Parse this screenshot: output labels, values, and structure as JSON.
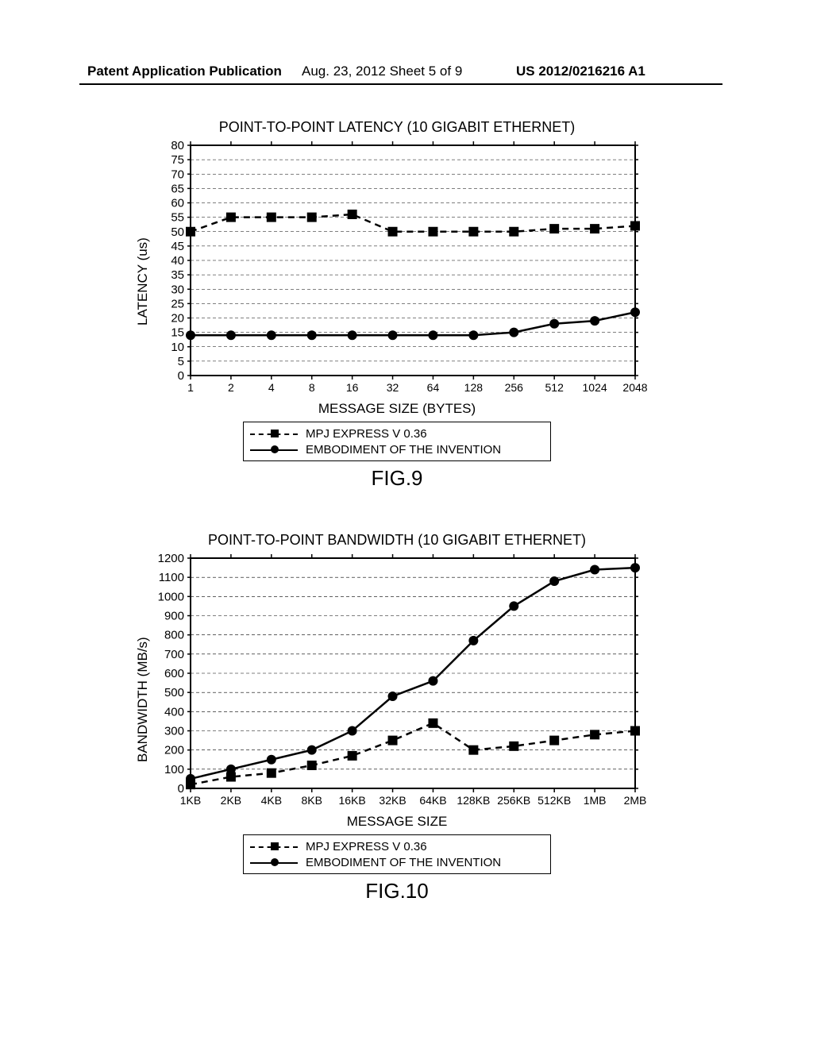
{
  "header": {
    "left": "Patent Application Publication",
    "center": "Aug. 23, 2012  Sheet 5 of 9",
    "right": "US 2012/0216216 A1"
  },
  "chart_data": [
    {
      "type": "line",
      "title": "POINT-TO-POINT LATENCY (10 GIGABIT ETHERNET)",
      "xlabel": "MESSAGE SIZE (BYTES)",
      "ylabel": "LATENCY (us)",
      "categories": [
        "1",
        "2",
        "4",
        "8",
        "16",
        "32",
        "64",
        "128",
        "256",
        "512",
        "1024",
        "2048"
      ],
      "ylim": [
        0,
        80
      ],
      "yticks": [
        0,
        5,
        10,
        15,
        20,
        25,
        30,
        35,
        40,
        45,
        50,
        55,
        60,
        65,
        70,
        75,
        80
      ],
      "series": [
        {
          "name": "MPJ EXPRESS V 0.36",
          "marker": "square",
          "dash": true,
          "values": [
            50,
            55,
            55,
            55,
            56,
            50,
            50,
            50,
            50,
            51,
            51,
            52
          ]
        },
        {
          "name": "EMBODIMENT OF THE INVENTION",
          "marker": "circle",
          "dash": false,
          "values": [
            14,
            14,
            14,
            14,
            14,
            14,
            14,
            14,
            15,
            18,
            19,
            22
          ]
        }
      ],
      "fig_label": "FIG.9"
    },
    {
      "type": "line",
      "title": "POINT-TO-POINT BANDWIDTH (10 GIGABIT ETHERNET)",
      "xlabel": "MESSAGE SIZE",
      "ylabel": "BANDWIDTH (MB/s)",
      "categories": [
        "1KB",
        "2KB",
        "4KB",
        "8KB",
        "16KB",
        "32KB",
        "64KB",
        "128KB",
        "256KB",
        "512KB",
        "1MB",
        "2MB"
      ],
      "ylim": [
        0,
        1200
      ],
      "yticks": [
        0,
        100,
        200,
        300,
        400,
        500,
        600,
        700,
        800,
        900,
        1000,
        1100,
        1200
      ],
      "series": [
        {
          "name": "MPJ EXPRESS V 0.36",
          "marker": "square",
          "dash": true,
          "values": [
            20,
            60,
            80,
            120,
            170,
            250,
            340,
            200,
            220,
            250,
            280,
            300
          ]
        },
        {
          "name": "EMBODIMENT OF THE INVENTION",
          "marker": "circle",
          "dash": false,
          "values": [
            50,
            100,
            150,
            200,
            300,
            480,
            560,
            770,
            950,
            1080,
            1140,
            1150
          ]
        }
      ],
      "fig_label": "FIG.10"
    }
  ]
}
